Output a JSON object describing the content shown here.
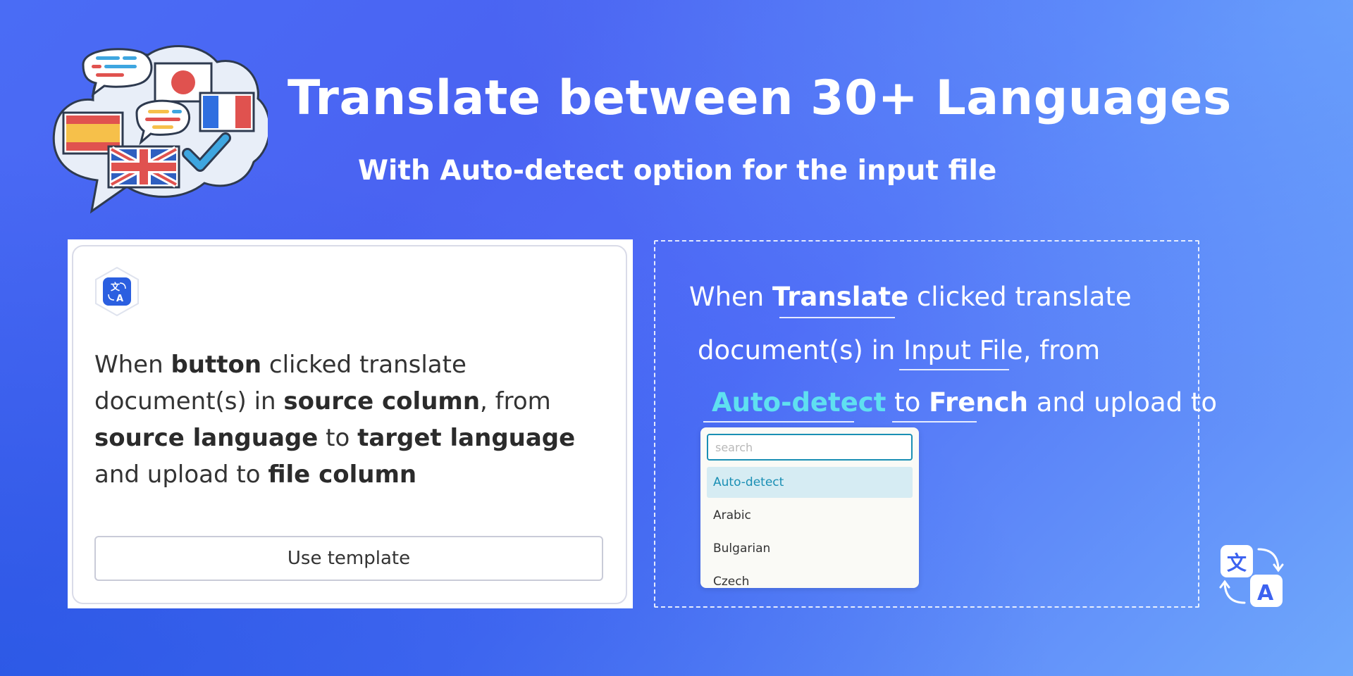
{
  "header": {
    "title": "Translate between 30+ Languages",
    "subtitle": "With Auto-detect option for the input file"
  },
  "template_card": {
    "text_parts": {
      "p1": "When ",
      "b1": "button",
      "p2": " clicked translate document(s) in ",
      "b2": "source column",
      "p3": ", from ",
      "b3": "source language",
      "p4": " to ",
      "b4": "target language",
      "p5": " and upload to ",
      "b5": "file column"
    },
    "button_label": "Use template"
  },
  "config_panel": {
    "line1": {
      "p1": "When ",
      "b1": "Translate",
      "p2": " clicked translate"
    },
    "line2": {
      "p1": "document(s) in ",
      "u1": "Input File",
      "p2": ", from"
    },
    "line3": {
      "a1": "Auto-detect",
      "p1": " to ",
      "b1": "French",
      "p2": " and upload to"
    }
  },
  "language_dropdown": {
    "search_placeholder": "search",
    "options": [
      "Auto-detect",
      "Arabic",
      "Bulgarian",
      "Czech"
    ],
    "selected": "Auto-detect"
  },
  "icons": {
    "hero": "language-speech-bubbles-flags-illustration",
    "card": "translate-icon",
    "corner": "translate-icon"
  },
  "colors": {
    "accent_cyan": "#5fe0f0",
    "dropdown_selected_bg": "#d6ecf3",
    "dropdown_selected_text": "#1a8fb4"
  }
}
